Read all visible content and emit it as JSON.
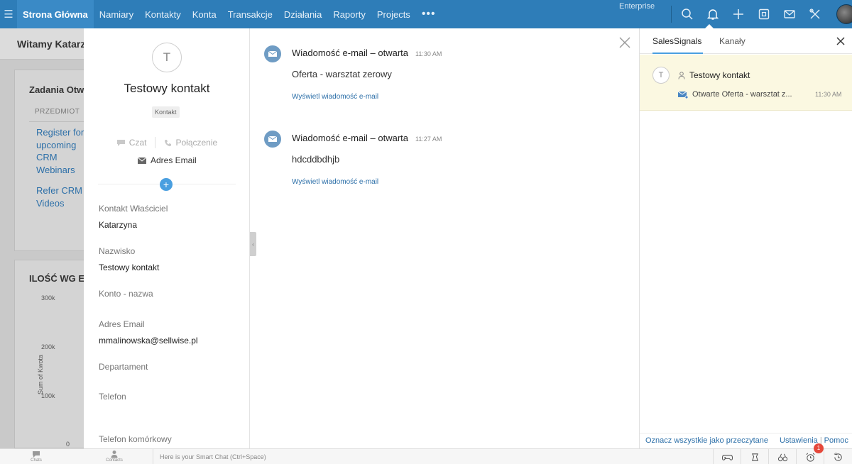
{
  "nav": {
    "items": [
      "Strona Główna",
      "Namiary",
      "Kontakty",
      "Konta",
      "Transakcje",
      "Działania",
      "Raporty",
      "Projects"
    ],
    "more": "•••",
    "edition": "Enterprise"
  },
  "dashboard": {
    "welcome": "Witamy Katarzyna",
    "tasks_title": "Zadania Otwarte",
    "tasks_column": "PRZEDMIOT",
    "tasks": [
      "Register for upcoming CRM Webinars",
      "Refer CRM Videos"
    ],
    "chart_title": "ILOŚĆ WG ETAPU",
    "y_ticks": [
      "300k",
      "200k",
      "100k",
      "0"
    ],
    "y_label": "Sum of Kwota"
  },
  "contact": {
    "initial": "T",
    "name": "Testowy kontakt",
    "type": "Kontakt",
    "chat_label": "Czat",
    "call_label": "Połączenie",
    "email_label": "Adres Email",
    "add": "+",
    "fields": [
      {
        "label": "Kontakt Właściciel",
        "value": "Katarzyna"
      },
      {
        "label": "Nazwisko",
        "value": "Testowy kontakt"
      },
      {
        "label": "Konto - nazwa",
        "value": ""
      },
      {
        "label": "Adres Email",
        "value": "mmalinowska@sellwise.pl"
      },
      {
        "label": "Departament",
        "value": ""
      },
      {
        "label": "Telefon",
        "value": ""
      },
      {
        "label": "Telefon komórkowy",
        "value": ""
      }
    ]
  },
  "feed": {
    "items": [
      {
        "title": "Wiadomość e-mail – otwarta",
        "time": "11:30 AM",
        "body": "Oferta - warsztat zerowy",
        "link": "Wyświetl wiadomość e-mail"
      },
      {
        "title": "Wiadomość e-mail – otwarta",
        "time": "11:27 AM",
        "body": "hdcddbdhjb",
        "link": "Wyświetl wiadomość e-mail"
      }
    ]
  },
  "signals": {
    "tabs": [
      "SalesSignals",
      "Kanały"
    ],
    "notification": {
      "initial": "T",
      "contact": "Testowy kontakt",
      "detail": "Otwarte Oferta - warsztat z...",
      "time": "11:30 AM"
    },
    "mark_all": "Oznacz wszystkie jako przeczytane",
    "settings": "Ustawienia",
    "separator": "|",
    "help": "Pomoc"
  },
  "bottom": {
    "chats": "Chats",
    "contacts": "Contacts",
    "smart_chat": "Here is your Smart Chat (Ctrl+Space)",
    "badge": "1"
  },
  "colors": {
    "nav_bg": "#2e7db8",
    "link": "#2c6fa8",
    "accent": "#4a9fe0",
    "notification_bg": "#fbf8e1"
  }
}
